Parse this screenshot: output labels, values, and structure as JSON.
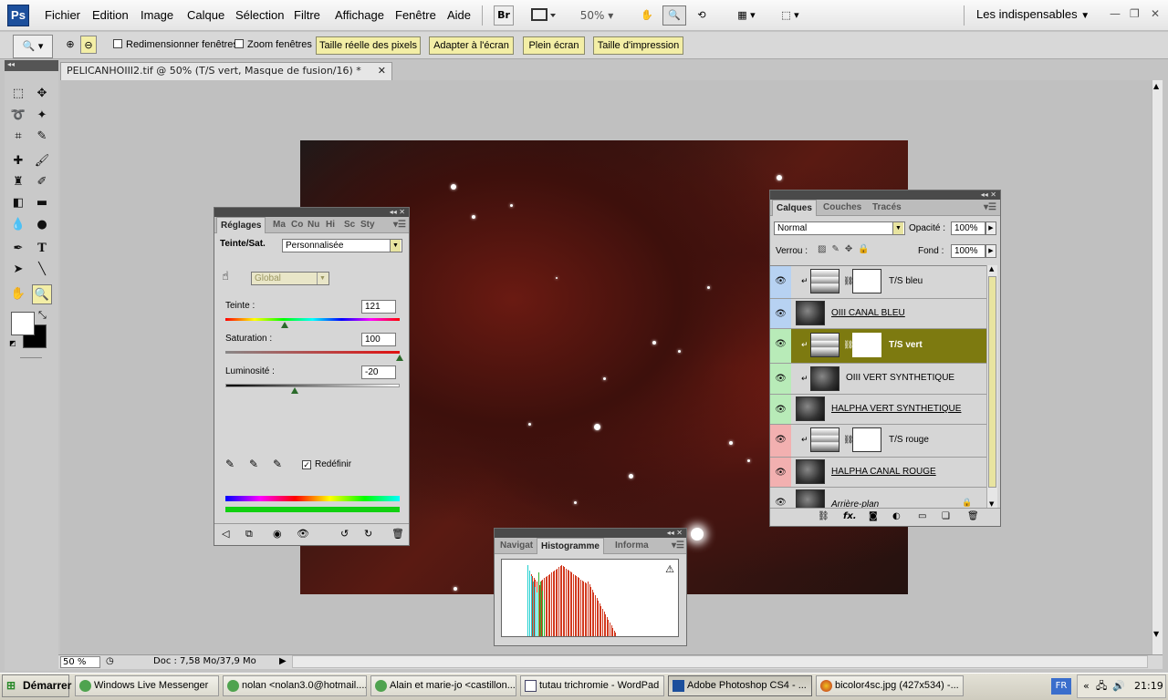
{
  "app": {
    "logo": "Ps"
  },
  "menubar": {
    "items": [
      "Fichier",
      "Edition",
      "Image",
      "Calque",
      "Sélection",
      "Filtre",
      "Affichage",
      "Fenêtre",
      "Aide"
    ],
    "bridge": "Br",
    "zoom": "50%",
    "workspace": "Les indispensables"
  },
  "options": {
    "resize_windows": "Redimensionner fenêtres",
    "zoom_all": "Zoom fenêtres",
    "btn_actual": "Taille réelle des pixels",
    "btn_fit": "Adapter à l'écran",
    "btn_full": "Plein écran",
    "btn_print": "Taille d'impression"
  },
  "document": {
    "tab_title": "PELICANHOIII2.tif @ 50% (T/S vert, Masque de fusion/16) *",
    "zoom": "50 %",
    "doc_info": "Doc : 7,58 Mo/37,9 Mo"
  },
  "adjustments": {
    "tabs": [
      "Réglages",
      "Ma",
      "Co",
      "Nu",
      "Hi",
      "Sc",
      "Sty"
    ],
    "title": "Teinte/Sat.",
    "preset": "Personnalisée",
    "channel": "Global",
    "hue_label": "Teinte :",
    "hue_value": "121",
    "hue_fraction": 0.34,
    "sat_label": "Saturation :",
    "sat_value": "100",
    "sat_fraction": 1.0,
    "light_label": "Luminosité :",
    "light_value": "-20",
    "light_fraction": 0.4,
    "colorize": "Redéfinir"
  },
  "layers": {
    "tabs": [
      "Calques",
      "Couches",
      "Tracés"
    ],
    "blend": "Normal",
    "opacity_label": "Opacité :",
    "opacity": "100%",
    "lock_label": "Verrou :",
    "fill_label": "Fond :",
    "fill": "100%",
    "items": [
      {
        "name": "T/S bleu",
        "color": "#b7d2f2",
        "type": "adj"
      },
      {
        "name": "OIII CANAL BLEU",
        "color": "#b7d2f2",
        "type": "img"
      },
      {
        "name": "T/S vert",
        "color": "#b8ebb8",
        "type": "adj"
      },
      {
        "name": "OIII VERT SYNTHETIQUE",
        "color": "#b8ebb8",
        "type": "img"
      },
      {
        "name": "HALPHA VERT SYNTHETIQUE",
        "color": "#b8ebb8",
        "type": "img"
      },
      {
        "name": "T/S rouge",
        "color": "#f2b0b0",
        "type": "adj"
      },
      {
        "name": "HALPHA CANAL ROUGE",
        "color": "#f2b0b0",
        "type": "img"
      },
      {
        "name": "Arrière-plan",
        "color": "#d6d6d6",
        "type": "img"
      }
    ]
  },
  "histogram": {
    "tabs": [
      "Navigat",
      "Histogramme",
      "Informa"
    ],
    "warning_icon": "warning-icon"
  },
  "taskbar": {
    "start": "Démarrer",
    "tasks": [
      "Windows Live Messenger",
      "nolan <nolan3.0@hotmail....",
      "Alain et marie-jo <castillon...",
      "tutau trichromie - WordPad",
      "Adobe Photoshop CS4 - ...",
      "bicolor4sc.jpg (427x534) -..."
    ],
    "lang": "FR",
    "clock": "21:19"
  }
}
